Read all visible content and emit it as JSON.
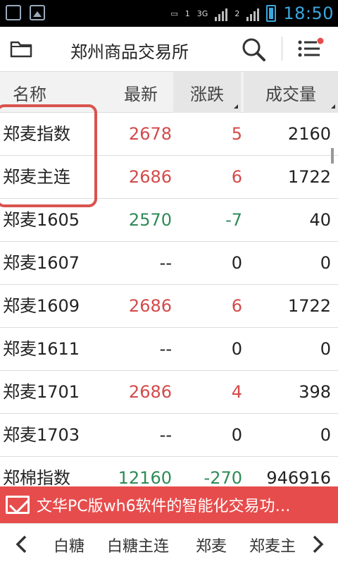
{
  "status_bar": {
    "time": "18:50",
    "network": "3G",
    "signal_a": "1",
    "signal_b": "2"
  },
  "app_bar": {
    "title": "郑州商品交易所"
  },
  "table": {
    "columns": [
      "名称",
      "最新",
      "涨跌",
      "成交量"
    ],
    "rows": [
      {
        "name": "郑麦指数",
        "last": "2678",
        "change": "5",
        "volume": "2160",
        "trend": "up"
      },
      {
        "name": "郑麦主连",
        "last": "2686",
        "change": "6",
        "volume": "1722",
        "trend": "up"
      },
      {
        "name": "郑麦1605",
        "last": "2570",
        "change": "-7",
        "volume": "40",
        "trend": "down"
      },
      {
        "name": "郑麦1607",
        "last": "--",
        "change": "0",
        "volume": "0",
        "trend": "flat"
      },
      {
        "name": "郑麦1609",
        "last": "2686",
        "change": "6",
        "volume": "1722",
        "trend": "up"
      },
      {
        "name": "郑麦1611",
        "last": "--",
        "change": "0",
        "volume": "0",
        "trend": "flat"
      },
      {
        "name": "郑麦1701",
        "last": "2686",
        "change": "4",
        "volume": "398",
        "trend": "up"
      },
      {
        "name": "郑麦1703",
        "last": "--",
        "change": "0",
        "volume": "0",
        "trend": "flat"
      },
      {
        "name": "郑棉指数",
        "last": "12160",
        "change": "-270",
        "volume": "946916",
        "trend": "down"
      }
    ]
  },
  "banner": {
    "text": "文华PC版wh6软件的智能化交易功…"
  },
  "tabs": {
    "items": [
      "白糖",
      "白糖主连",
      "郑麦",
      "郑麦主"
    ]
  },
  "colors": {
    "up": "#d44a4a",
    "down": "#2e8b57",
    "banner": "#e74c4c",
    "time": "#3aa7e0"
  }
}
